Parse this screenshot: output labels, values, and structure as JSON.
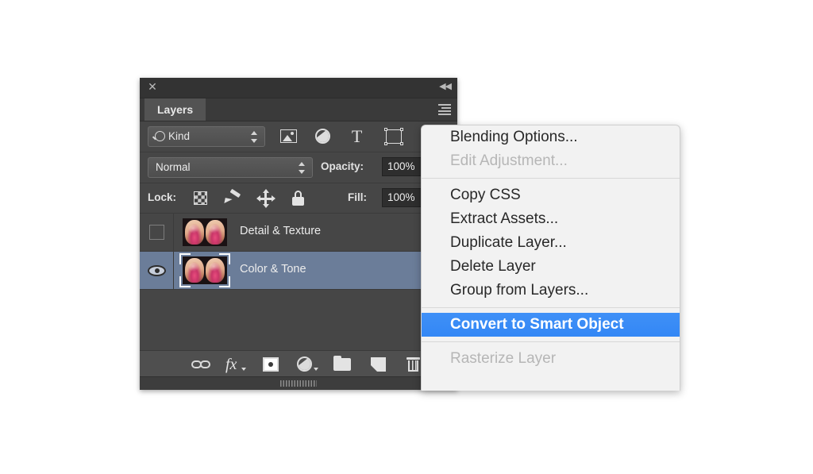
{
  "panel": {
    "title_bar": {
      "close_icon": "close-icon",
      "collapse_icon": "collapse-to-icons-icon",
      "collapse_glyph": "◀◀"
    },
    "tab_label": "Layers",
    "menu_icon": "panel-menu-icon",
    "filter": {
      "kind_label": "Kind",
      "search_icon": "search-icon",
      "icons": [
        {
          "name": "filter-pixel-layers-icon",
          "title": "Pixel layers"
        },
        {
          "name": "filter-adjustment-layers-icon",
          "title": "Adjustment layers"
        },
        {
          "name": "filter-type-layers-icon",
          "title": "Type layers"
        },
        {
          "name": "filter-shape-layers-icon",
          "title": "Shape layers"
        },
        {
          "name": "filter-smart-object-layers-icon",
          "title": "Smart object layers"
        }
      ]
    },
    "blend": {
      "mode": "Normal",
      "opacity_label": "Opacity:",
      "opacity_value": "100%"
    },
    "lock": {
      "label": "Lock:",
      "icons": [
        {
          "name": "lock-transparent-pixels-icon"
        },
        {
          "name": "lock-image-pixels-icon"
        },
        {
          "name": "lock-position-icon"
        },
        {
          "name": "lock-all-icon"
        }
      ],
      "fill_label": "Fill:",
      "fill_value": "100%"
    },
    "layers": [
      {
        "name": "Detail & Texture",
        "visible": false,
        "selected": false,
        "thumbnail": "two-portrait-faces-thumbnail"
      },
      {
        "name": "Color & Tone",
        "visible": true,
        "selected": true,
        "thumbnail": "two-portrait-faces-thumbnail"
      }
    ],
    "bottom_toolbar": [
      {
        "name": "link-layers-icon"
      },
      {
        "name": "layer-style-fx-icon"
      },
      {
        "name": "add-layer-mask-icon"
      },
      {
        "name": "new-adjustment-layer-icon"
      },
      {
        "name": "new-group-icon"
      },
      {
        "name": "new-layer-icon"
      },
      {
        "name": "delete-layer-icon"
      }
    ],
    "resize_grip": "panel-resize-grip"
  },
  "context_menu": {
    "items": [
      {
        "label": "Blending Options...",
        "state": "normal"
      },
      {
        "label": "Edit Adjustment...",
        "state": "disabled"
      },
      {
        "label": "__SEP__",
        "state": "separator"
      },
      {
        "label": "Copy CSS",
        "state": "normal"
      },
      {
        "label": "Extract Assets...",
        "state": "normal"
      },
      {
        "label": "Duplicate Layer...",
        "state": "normal"
      },
      {
        "label": "Delete Layer",
        "state": "normal"
      },
      {
        "label": "Group from Layers...",
        "state": "normal"
      },
      {
        "label": "__SEP__",
        "state": "separator"
      },
      {
        "label": "Convert to Smart Object",
        "state": "highlighted"
      },
      {
        "label": "__SEP__",
        "state": "separator"
      },
      {
        "label": "Rasterize Layer",
        "state": "disabled"
      }
    ]
  },
  "colors": {
    "page_background": "#ffffff",
    "panel_background": "#464646",
    "panel_titlebar": "#333333",
    "panel_tab_active": "#535353",
    "selected_layer_row": "#6b7d99",
    "menu_background": "#f2f2f2",
    "menu_highlight_blue": "#3387f5",
    "menu_text": "#282828",
    "menu_disabled_text": "#b6b6b6"
  }
}
